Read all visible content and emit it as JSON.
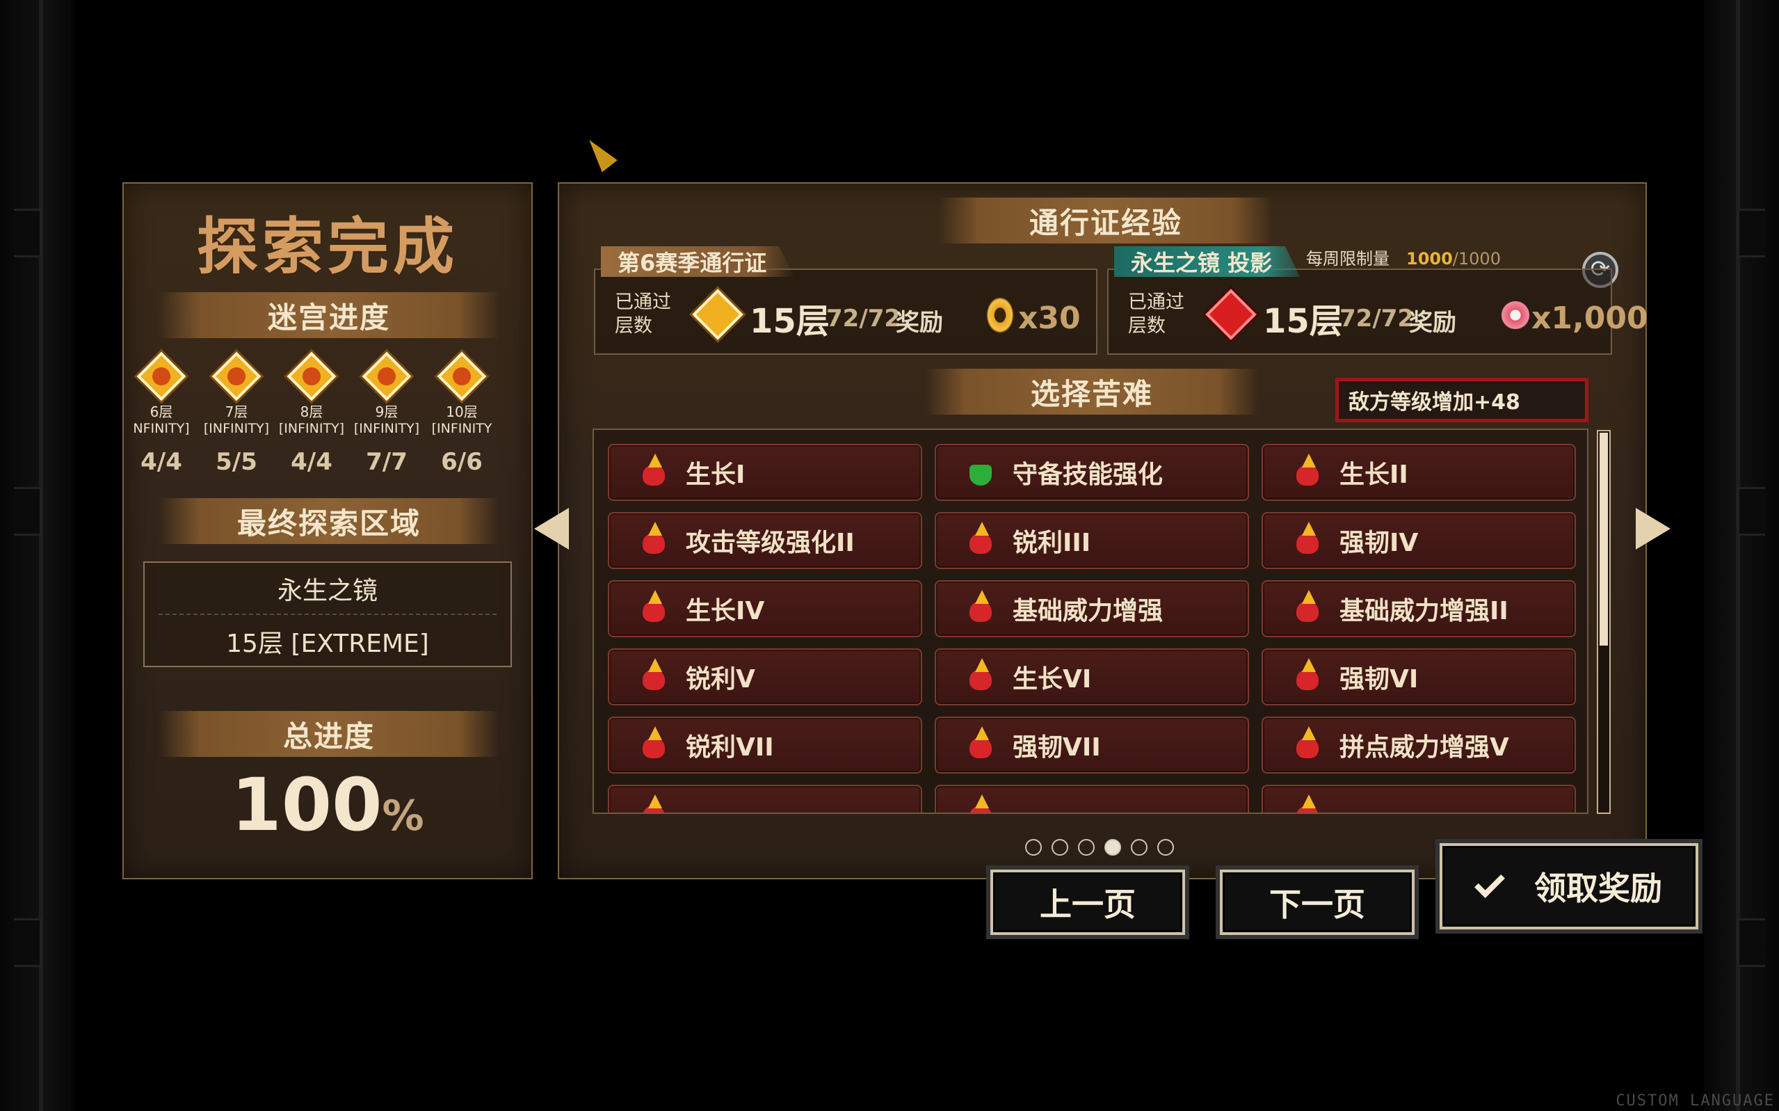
{
  "exploration": {
    "title": "探索完成",
    "maze_progress_label": "迷宫进度",
    "floors": [
      {
        "floor": "6层",
        "mode": "NFINITY]",
        "count": "4/4"
      },
      {
        "floor": "7层",
        "mode": "[INFINITY]",
        "count": "5/5"
      },
      {
        "floor": "8层",
        "mode": "[INFINITY]",
        "count": "4/4"
      },
      {
        "floor": "9层",
        "mode": "[INFINITY]",
        "count": "7/7"
      },
      {
        "floor": "10层",
        "mode": "[INFINITY",
        "count": "6/6"
      }
    ],
    "final_area_label": "最终探索区域",
    "final_area_name": "永生之镜",
    "final_area_floor": "15层 [EXTREME]",
    "total_progress_label": "总进度",
    "total_progress_value": "100",
    "total_progress_unit": "%"
  },
  "pass_exp": {
    "title": "通行证经验",
    "weekly_limit_label": "每周限制量",
    "weekly_current": "1000",
    "weekly_max": "/1000",
    "season_pass": {
      "tag": "第6赛季通行证",
      "cleared_label_1": "已通过",
      "cleared_label_2": "层数",
      "layer": "15层",
      "ratio": "72/72",
      "reward_label": "奖励",
      "reward_amount": "x30",
      "reward_icon": "gold-coin-icon"
    },
    "mirror_pass": {
      "tag": "永生之镜 投影",
      "cleared_label_1": "已通过",
      "cleared_label_2": "层数",
      "layer": "15层",
      "ratio": "72/72",
      "reward_label": "奖励",
      "reward_amount": "x1,000",
      "reward_icon": "flower-icon"
    }
  },
  "hardship": {
    "title": "选择苦难",
    "enemy_bonus": "敌方等级增加+48",
    "items": [
      {
        "label": "生长I",
        "icon": "growth-icon"
      },
      {
        "label": "守备技能强化",
        "icon": "shield-icon"
      },
      {
        "label": "生长II",
        "icon": "growth-icon"
      },
      {
        "label": "攻击等级强化II",
        "icon": "attack-icon"
      },
      {
        "label": "锐利III",
        "icon": "sharp-icon"
      },
      {
        "label": "强韧IV",
        "icon": "tough-icon"
      },
      {
        "label": "生长IV",
        "icon": "growth-icon"
      },
      {
        "label": "基础威力增强",
        "icon": "power-icon"
      },
      {
        "label": "基础威力增强II",
        "icon": "power-icon"
      },
      {
        "label": "锐利V",
        "icon": "sharp-icon"
      },
      {
        "label": "生长VI",
        "icon": "growth-icon"
      },
      {
        "label": "强韧VI",
        "icon": "tough-icon"
      },
      {
        "label": "锐利VII",
        "icon": "sharp-icon"
      },
      {
        "label": "强韧VII",
        "icon": "tough-icon"
      },
      {
        "label": "拼点威力增强V",
        "icon": "clash-icon"
      }
    ],
    "page_dots": 6,
    "current_page": 4
  },
  "buttons": {
    "prev": "上一页",
    "next": "下一页",
    "claim": "领取奖励"
  },
  "watermark": "CUSTOM LANGUAGE"
}
